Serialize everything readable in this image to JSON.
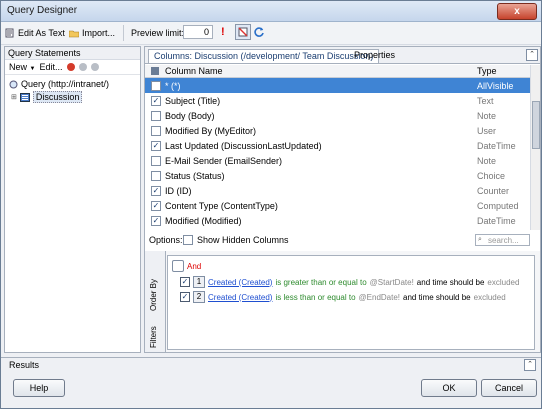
{
  "window": {
    "title": "Query Designer",
    "close_glyph": "x"
  },
  "toolbar": {
    "edit_as_text": "Edit As Text",
    "import": "Import...",
    "preview_limit_label": "Preview limit:",
    "preview_limit_value": "0",
    "warning_glyph": "!"
  },
  "left": {
    "header": "Query Statements",
    "new_label": "New",
    "edit_label": "Edit...",
    "tree": [
      {
        "label": "Query (http://intranet/)"
      },
      {
        "label": "Discussion"
      }
    ]
  },
  "tabs": [
    {
      "label": "Columns: Discussion (/development/ Team Discussion)",
      "active": true
    },
    {
      "label": "Properties",
      "active": false
    }
  ],
  "grid": {
    "headers": {
      "name": "Column Name",
      "type": "Type"
    },
    "rows": [
      {
        "name": "* (*)",
        "type": "AllVisible",
        "checked": false,
        "selected": true
      },
      {
        "name": "Subject (Title)",
        "type": "Text",
        "checked": true,
        "selected": false
      },
      {
        "name": "Body (Body)",
        "type": "Note",
        "checked": false,
        "selected": false
      },
      {
        "name": "Modified By (MyEditor)",
        "type": "User",
        "checked": false,
        "selected": false
      },
      {
        "name": "Last Updated (DiscussionLastUpdated)",
        "type": "DateTime",
        "checked": true,
        "selected": false
      },
      {
        "name": "E-Mail Sender (EmailSender)",
        "type": "Note",
        "checked": false,
        "selected": false
      },
      {
        "name": "Status (Status)",
        "type": "Choice",
        "checked": false,
        "selected": false
      },
      {
        "name": "ID (ID)",
        "type": "Counter",
        "checked": true,
        "selected": false
      },
      {
        "name": "Content Type (ContentType)",
        "type": "Computed",
        "checked": true,
        "selected": false
      },
      {
        "name": "Modified (Modified)",
        "type": "DateTime",
        "checked": true,
        "selected": false
      }
    ]
  },
  "options": {
    "label": "Options:",
    "show_hidden": "Show Hidden Columns",
    "search_placeholder": "search..."
  },
  "filters": {
    "vtab_order_by": "Order By",
    "vtab_filters": "Filters",
    "group_label": "And",
    "items": [
      {
        "index": "1",
        "field": "Created (Created)",
        "op": "is greater than or equal to",
        "value": "@StartDate!",
        "tail": "and time should be",
        "time": "excluded"
      },
      {
        "index": "2",
        "field": "Created (Created)",
        "op": "is less than or equal to",
        "value": "@EndDate!",
        "tail": "and time should be",
        "time": "excluded"
      }
    ]
  },
  "results": {
    "label": "Results"
  },
  "footer": {
    "help": "Help",
    "ok": "OK",
    "cancel": "Cancel"
  }
}
